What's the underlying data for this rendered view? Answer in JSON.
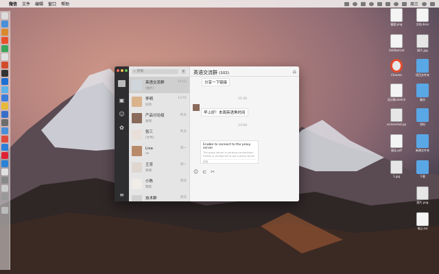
{
  "menubar": {
    "apple": "",
    "items": [
      "微信",
      "文件",
      "编辑",
      "窗口",
      "帮助"
    ],
    "tray_clock": "周三"
  },
  "wechat": {
    "search_placeholder": "搜索",
    "plus": "+",
    "chat_title": "英语交流群",
    "chat_count": "(102)",
    "chats": [
      {
        "name": "英语交流群",
        "preview": "[图片]",
        "time": "14:02",
        "selected": true
      },
      {
        "name": "李明",
        "preview": "好的",
        "time": "13:55",
        "selected": false
      },
      {
        "name": "产品讨论组",
        "preview": "收到",
        "time": "昨天",
        "selected": false
      },
      {
        "name": "张三",
        "preview": "[文件]",
        "time": "昨天",
        "selected": false
      },
      {
        "name": "Lisa",
        "preview": "ok",
        "time": "周一",
        "selected": false
      },
      {
        "name": "王芳",
        "preview": "谢谢",
        "time": "周一",
        "selected": false
      },
      {
        "name": "小陈",
        "preview": "嗯嗯",
        "time": "周日",
        "selected": false
      },
      {
        "name": "技术群",
        "preview": "...",
        "time": "周日",
        "selected": false
      }
    ],
    "messages": {
      "msg1": "分享一下链接",
      "msg2": "早上好！本周英语角时间",
      "ts1": "12:30",
      "ts2": "13:00",
      "card_title": "Enable to connect to the proxy server",
      "card_desc1": "The proxy server is refusing connections",
      "card_desc2": "Firefox is configured to use a proxy server",
      "card_footer": "链接"
    },
    "tools": {
      "emoji": "☺",
      "file": "⊏",
      "scissors": "✂"
    },
    "menu": "⌂"
  },
  "desktop": {
    "icons": [
      {
        "label": "截图.png"
      },
      {
        "label": "文档.docx"
      },
      {
        "label": "Untitled.txt"
      },
      {
        "label": "照片.jpg"
      },
      {
        "label": "Chrome"
      },
      {
        "label": "项目文件夹"
      },
      {
        "label": "设计稿.sketch"
      },
      {
        "label": "备份"
      },
      {
        "label": "screenshot.jpg"
      },
      {
        "label": "资料"
      },
      {
        "label": "报告.pdf"
      },
      {
        "label": "新建文件夹"
      },
      {
        "label": "1.jpg"
      },
      {
        "label": "下载"
      },
      {
        "label": "图片.png"
      },
      {
        "label": "笔记.txt"
      }
    ]
  }
}
